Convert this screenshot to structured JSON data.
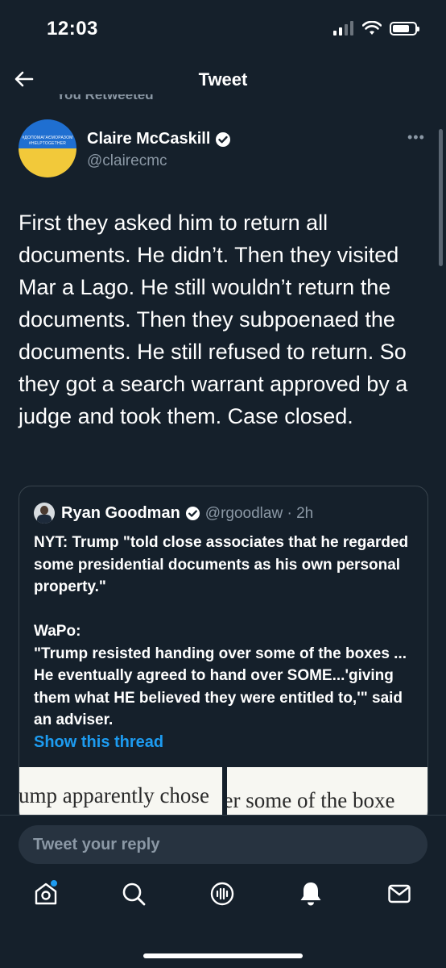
{
  "status_bar": {
    "time": "12:03",
    "battery_level": 0.75
  },
  "nav": {
    "title": "Tweet",
    "back_icon": "arrow-left-icon"
  },
  "retweet_context": {
    "label": "You Retweeted"
  },
  "author": {
    "name": "Claire McCaskill",
    "handle": "@clairecmc",
    "avatar_text_line1": "#ДОПОМАГАЄМОРАЗОМ",
    "avatar_text_line2": "#HELPTOGETHER",
    "avatar_colors": [
      "#1f6fd1",
      "#f2c93a"
    ],
    "verified": true
  },
  "tweet": {
    "text": "First they asked him to return all documents. He didn’t. Then they visited Mar a Lago. He still wouldn’t return the documents. Then they subpoenaed the documents. He still refused to return. So they got a search warrant approved by a judge and took them. Case closed."
  },
  "quoted_tweet": {
    "name": "Ryan Goodman",
    "handle": "@rgoodlaw · 2h",
    "verified": true,
    "text": "NYT: Trump \"told close associates that he regarded some presidential documents as his own personal property.\"\n\nWaPo:\n\"Trump resisted handing over some of the boxes ... He eventually agreed to hand over SOME...'giving them what HE believed they were entitled to,'\" said an adviser.",
    "show_thread": "Show this thread",
    "image_left_text": "ump apparently chose",
    "image_right_text": "er some of the boxe"
  },
  "reply": {
    "placeholder": "Tweet your reply"
  },
  "tab_bar": {
    "items": [
      "home-icon",
      "search-icon",
      "spaces-icon",
      "notifications-icon",
      "messages-icon"
    ]
  },
  "colors": {
    "background": "#15202b",
    "accent": "#1d9bf0",
    "secondary_text": "#8b98a5"
  }
}
